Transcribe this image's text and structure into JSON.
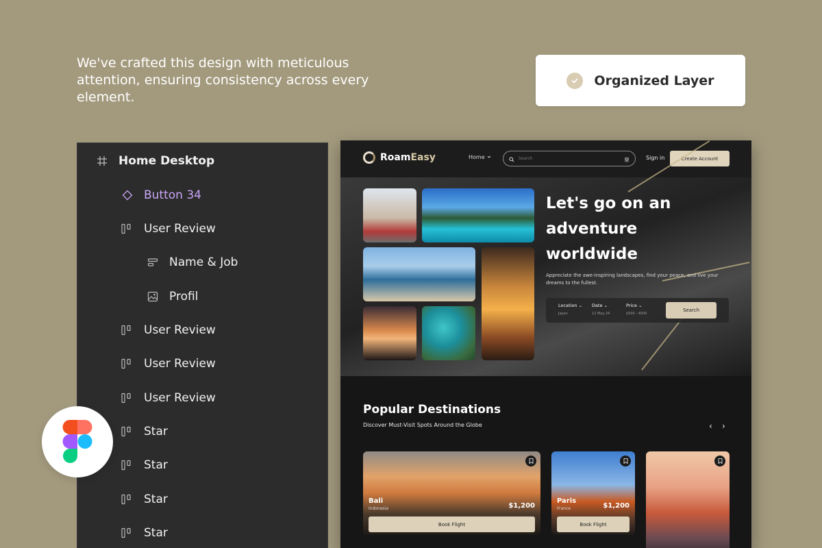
{
  "intro": "We've crafted this design with meticulous attention, ensuring consistency across every element.",
  "badge": {
    "label": "Organized Layer"
  },
  "layers": [
    {
      "label": "Home Desktop",
      "icon": "frame-icon"
    },
    {
      "label": "Button 34",
      "icon": "component-icon"
    },
    {
      "label": "User Review",
      "icon": "auto-layout-icon"
    },
    {
      "label": "Name & Job",
      "icon": "text-layout-icon"
    },
    {
      "label": "Profil",
      "icon": "image-icon"
    },
    {
      "label": "User Review",
      "icon": "auto-layout-icon"
    },
    {
      "label": "User Review",
      "icon": "auto-layout-icon"
    },
    {
      "label": "User Review",
      "icon": "auto-layout-icon"
    },
    {
      "label": "Star",
      "icon": "auto-layout-icon"
    },
    {
      "label": "Star",
      "icon": "auto-layout-icon"
    },
    {
      "label": "Star",
      "icon": "auto-layout-icon"
    },
    {
      "label": "Star",
      "icon": "auto-layout-icon"
    }
  ],
  "site": {
    "brand_a": "Roam",
    "brand_b": "Easy",
    "nav_home": "Home",
    "search_placeholder": "Search",
    "sign_in": "Sign in",
    "create_account": "Create Account",
    "hero_title": "Let's go on an adventure worldwide",
    "hero_sub": "Appreciate the awe-inspiring landscapes, find your peace, and live your dreams to the fullest.",
    "booking": {
      "location_label": "Location",
      "location_value": "Japan",
      "date_label": "Date",
      "date_value": "12 May 24",
      "price_label": "Price",
      "price_value": "$500 - 4000",
      "search_button": "Search"
    },
    "popular_title": "Popular Destinations",
    "popular_sub": "Discover Must-Visit Spots Around the Globe",
    "destinations": [
      {
        "name": "Bali",
        "country": "Indonesia",
        "price": "$1,200",
        "button": "Book Flight"
      },
      {
        "name": "Paris",
        "country": "France",
        "price": "$1,200",
        "button": "Book Flight"
      }
    ]
  },
  "colors": {
    "background": "#a39a7e",
    "accent": "#e0d4bd",
    "layer_highlight": "#c9a6f5"
  }
}
